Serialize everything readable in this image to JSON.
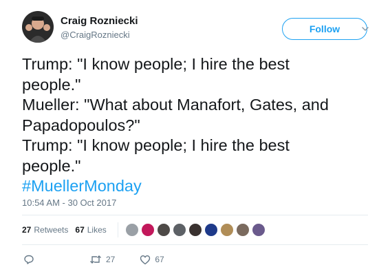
{
  "author": {
    "display_name": "Craig Rozniecki",
    "screen_name": "@CraigRozniecki"
  },
  "follow_label": "Follow",
  "tweet": {
    "lines": [
      "Trump: \"I know people; I hire the best",
      "people.\"",
      "Mueller: \"What about Manafort, Gates, and",
      "Papadopoulos?\"",
      "Trump: \"I know people; I hire the best",
      "people.\""
    ],
    "hashtag": "#MuellerMonday",
    "timestamp": "10:54 AM - 30 Oct 2017"
  },
  "stats": {
    "retweets_count": "27",
    "retweets_label": "Retweets",
    "likes_count": "67",
    "likes_label": "Likes"
  },
  "liker_avatars": [
    {
      "color": "#9aa0a6"
    },
    {
      "color": "#c2185b"
    },
    {
      "color": "#4e4a47"
    },
    {
      "color": "#5d6166"
    },
    {
      "color": "#3a3230"
    },
    {
      "color": "#1e3a8a"
    },
    {
      "color": "#b08d57"
    },
    {
      "color": "#7a6a5e"
    },
    {
      "color": "#6a5a8c"
    }
  ],
  "actions": {
    "retweet_count": "27",
    "like_count": "67"
  },
  "colors": {
    "accent": "#1da1f2",
    "secondary_text": "#657786",
    "divider": "#e6ecf0"
  }
}
